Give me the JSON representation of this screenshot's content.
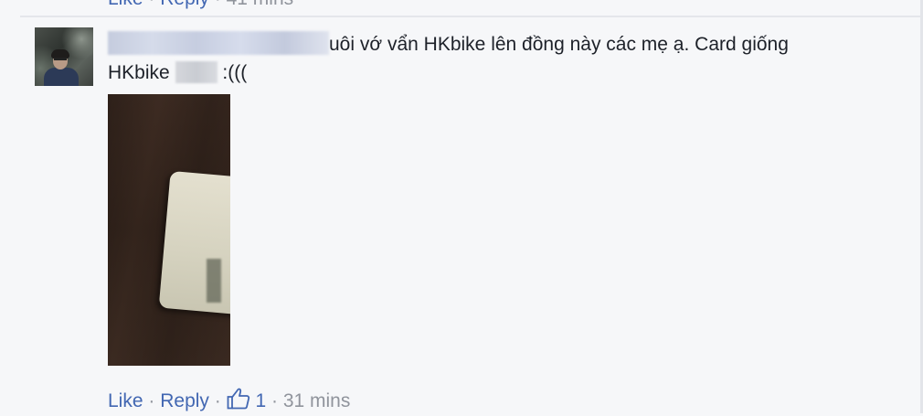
{
  "previous_comment": {
    "like_label": "Like",
    "separator": "·",
    "reply_label": "Reply",
    "timestamp": "41 mins"
  },
  "comment": {
    "text_part1": "uôi vớ vẩn HKbike lên đồng này các mẹ ạ. Card giống",
    "text_part2": "HKbike",
    "text_part3": ":(((",
    "actions": {
      "like_label": "Like",
      "separator": "·",
      "reply_label": "Reply",
      "like_count": "1",
      "timestamp": "31 mins"
    }
  },
  "colors": {
    "link": "#4267b2",
    "meta": "#90949c",
    "text": "#1d2129",
    "background": "#f6f7f9"
  },
  "icons": {
    "like": "thumbs-up-icon"
  }
}
